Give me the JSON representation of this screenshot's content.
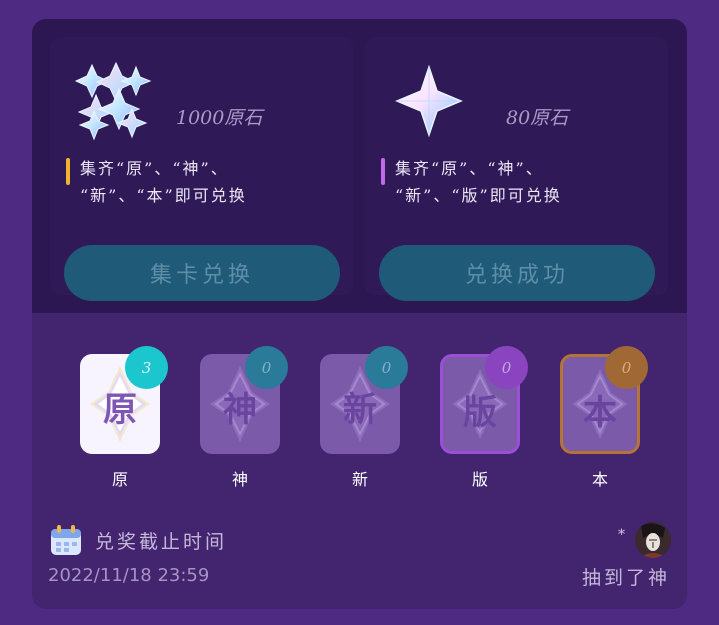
{
  "rewards": [
    {
      "amount": "1000原石",
      "note_line1": "集齐“原”、“神”、",
      "note_line2": "“新”、“本”即可兑换",
      "accent": "#f0b32a",
      "button_label": "集卡兑换",
      "gem_icon": "primogem-cluster-icon"
    },
    {
      "amount": "80原石",
      "note_line1": "集齐“原”、“神”、",
      "note_line2": "“新”、“版”即可兑换",
      "accent": "#c26ae8",
      "button_label": "兑换成功",
      "gem_icon": "primogem-icon"
    }
  ],
  "cards": [
    {
      "char": "原",
      "count": "3",
      "label": "原",
      "badge_color": "#1cc6cf",
      "frame": "none",
      "owned": true
    },
    {
      "char": "神",
      "count": "0",
      "label": "神",
      "badge_color": "#2a7b9a",
      "frame": "none",
      "owned": false
    },
    {
      "char": "新",
      "count": "0",
      "label": "新",
      "badge_color": "#2a7b9a",
      "frame": "none",
      "owned": false
    },
    {
      "char": "版",
      "count": "0",
      "label": "版",
      "badge_color": "#8a44c0",
      "frame": "#9a4fd6",
      "owned": false
    },
    {
      "char": "本",
      "count": "0",
      "label": "本",
      "badge_color": "#a06834",
      "frame": "#b57434",
      "owned": false
    }
  ],
  "footer": {
    "deadline_label": "兑奖截止时间",
    "deadline_date": "2022/11/18 23:59",
    "star": "*",
    "draw_label": "抽到了神",
    "calendar_icon": "calendar-icon",
    "avatar_icon": "user-avatar"
  },
  "colors": {
    "background": "#4f2a82",
    "panel": "#43246f",
    "button": "#1f5a78"
  }
}
